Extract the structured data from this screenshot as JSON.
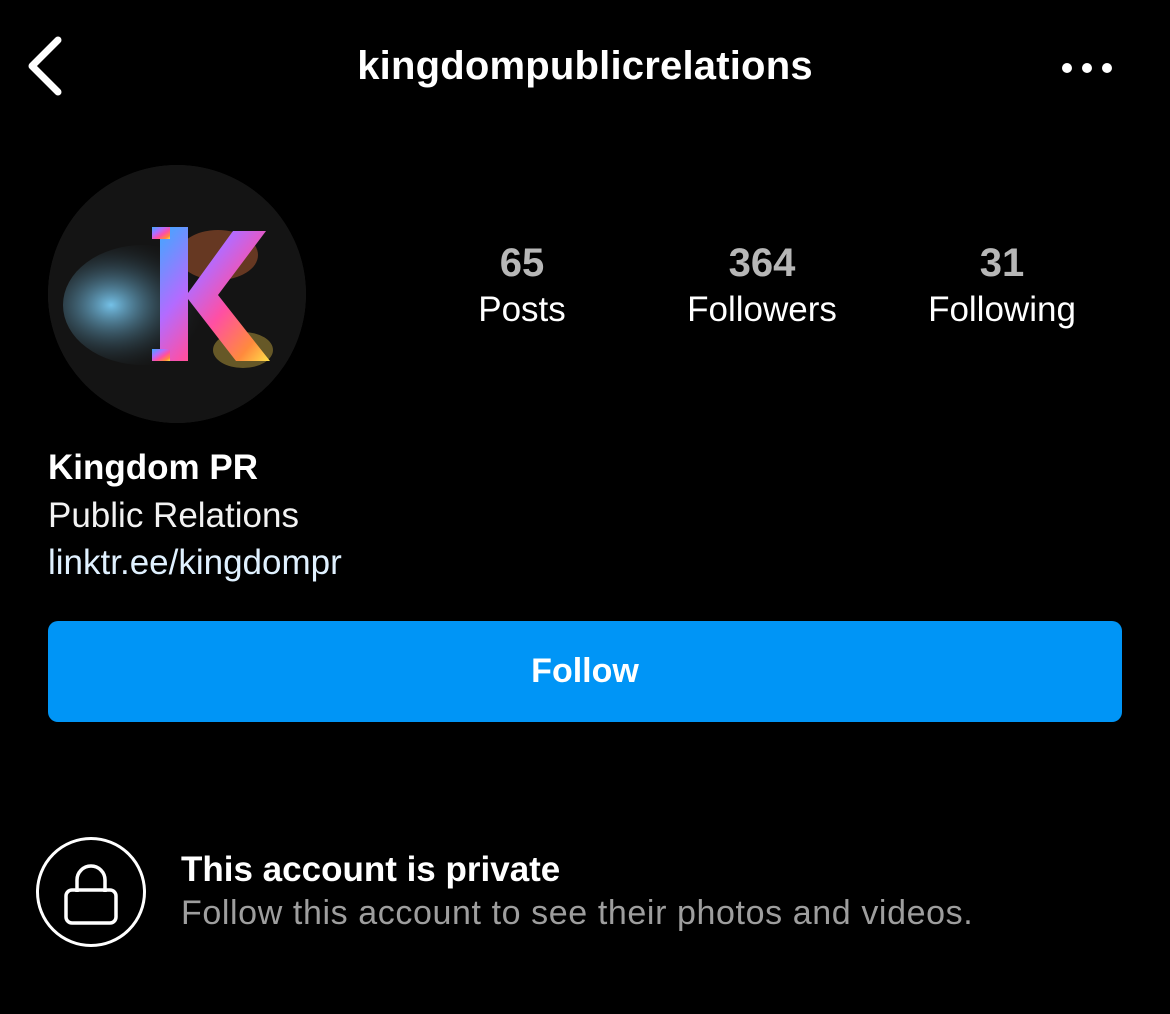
{
  "header": {
    "username": "kingdompublicrelations",
    "back_icon": "chevron-left-icon",
    "more_icon": "more-horizontal-icon"
  },
  "profile": {
    "avatar_logo_letter": "K",
    "stats": [
      {
        "value": "65",
        "label": "Posts"
      },
      {
        "value": "364",
        "label": "Followers"
      },
      {
        "value": "31",
        "label": "Following"
      }
    ],
    "display_name": "Kingdom PR",
    "category": "Public Relations",
    "link": "linktr.ee/kingdompr"
  },
  "actions": {
    "follow_label": "Follow"
  },
  "private_notice": {
    "icon": "lock-icon",
    "title": "This account is private",
    "subtitle": "Follow this account to see their photos and videos."
  },
  "colors": {
    "background": "#000000",
    "accent": "#0095f6",
    "secondary_text": "#9e9e9e"
  }
}
